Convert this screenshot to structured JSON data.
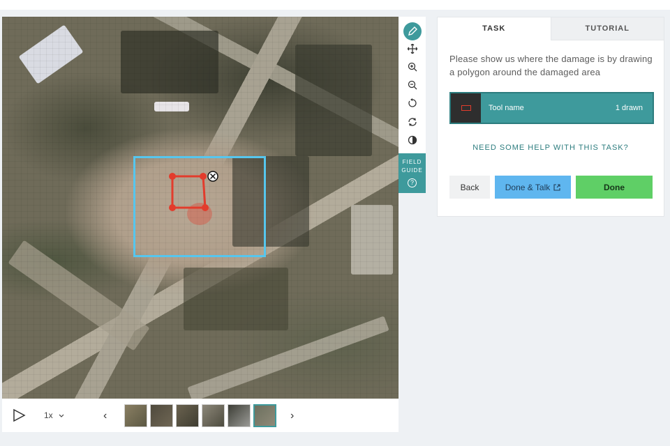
{
  "viewer": {
    "subject_image": "satellite-damage-image",
    "selection_color": "#56c6ee",
    "polygon_color": "#e23c2c",
    "delete_mark_glyph": "⊗"
  },
  "toolbar": {
    "tools": [
      "pencil-icon",
      "move-icon",
      "zoom-in-icon",
      "zoom-out-icon",
      "rotate-left-icon",
      "reset-icon",
      "invert-icon"
    ],
    "field_guide_line1": "FIELD",
    "field_guide_line2": "GUIDE",
    "field_guide_glyph": "?"
  },
  "controls": {
    "speed": "1x",
    "prev_glyph": "‹",
    "next_glyph": "›",
    "frame_count": 6,
    "active_frame": 6
  },
  "task": {
    "tab_task": "TASK",
    "tab_tutorial": "TUTORIAL",
    "question": "Please show us where the damage is by drawing a polygon around the damaged area",
    "tool_name": "Tool name",
    "tool_count": "1 drawn",
    "help_link": "NEED SOME HELP WITH THIS TASK?",
    "back": "Back",
    "done_talk": "Done & Talk",
    "done": "Done",
    "accent_color": "#3e9a9c"
  }
}
